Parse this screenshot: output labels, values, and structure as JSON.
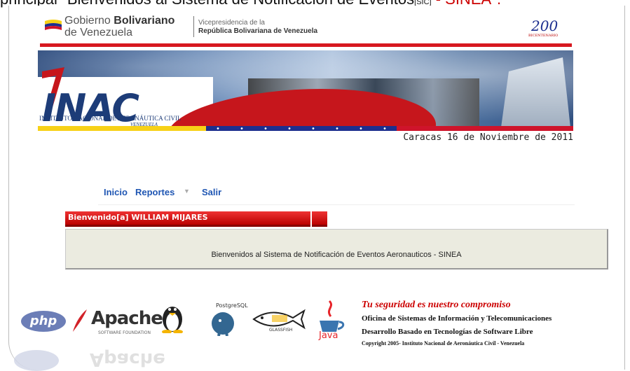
{
  "caption": {
    "prefix": "principal \"Bienvenidos al Sistema de Notificación de Eventos",
    "sup": "[SIC]",
    "suffix": " - SINEA\"."
  },
  "gov": {
    "name_line1_a": "Gobierno ",
    "name_line1_b": "Bolivariano",
    "name_line2": "de Venezuela",
    "vice_line1": "Vicepresidencia de la",
    "vice_line2": "República Bolivariana de Venezuela",
    "bicentenario_logo_text": "200",
    "bicentenario_label": "BICENTENARIO"
  },
  "banner": {
    "brand": "INAC",
    "subtitle": "INSTITUTO NACIONAL DE AERONÁUTICA CIVIL",
    "country": "VENEZUELA"
  },
  "date_text": "Caracas 16 de Noviembre de 2011",
  "menu": {
    "inicio": "Inicio",
    "reportes": "Reportes",
    "caret": "▼",
    "salir": "Salir"
  },
  "welcome": {
    "tab_label": "Bienvenido[a] WILLIAM MIJARES",
    "message": "Bienvenidos al Sistema de Notificación de Eventos Aeronauticos - SINEA"
  },
  "footer": {
    "php": "php",
    "apache": "Apache",
    "apache_sub": "SOFTWARE FOUNDATION",
    "postgres": "PostgreSQL",
    "glassfish": "GLASSFISH",
    "java": "Java",
    "slogan": "Tu seguridad es nuestro compromiso",
    "office": "Oficina de Sistemas de Información y Telecomunicaciones",
    "devel": "Desarrollo Basado en Tecnologías de  Software Libre",
    "copyright": "Copyright 2005- Instituto Nacional de Aeronáutica Civil - Venezuela"
  },
  "colors": {
    "menu_link": "#1f56b3",
    "welcome_red": "#cc1111",
    "panel_bg": "#ebebe0",
    "slogan_red": "#cc0000"
  }
}
